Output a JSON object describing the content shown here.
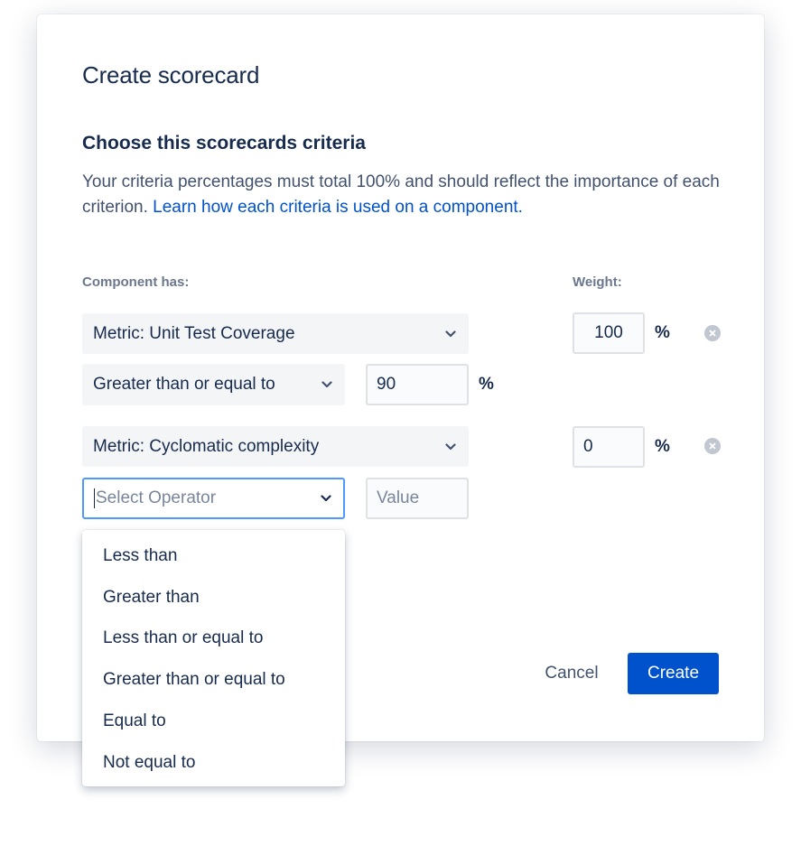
{
  "modal": {
    "title": "Create scorecard",
    "section_title": "Choose this scorecards criteria",
    "description": "Your criteria percentages must total 100% and should reflect the importance of each criterion. ",
    "learn_link": "Learn how each criteria is used on a component."
  },
  "columns": {
    "component_has": "Component has:",
    "weight": "Weight:"
  },
  "criteria": [
    {
      "metric": "Metric: Unit Test Coverage",
      "operator": "Greater than or equal to",
      "value": "90",
      "value_unit": "%",
      "weight": "100",
      "weight_unit": "%"
    },
    {
      "metric": "Metric: Cyclomatic complexity",
      "operator_placeholder": "Select Operator",
      "value_placeholder": "Value",
      "weight": "0",
      "weight_unit": "%"
    }
  ],
  "operator_menu": [
    "Less than",
    "Greater than",
    "Less than or equal to",
    "Greater than or equal to",
    "Equal to",
    "Not equal to"
  ],
  "footer": {
    "cancel": "Cancel",
    "create": "Create"
  },
  "colors": {
    "primary": "#0052CC",
    "focus": "#4C9AFF",
    "text": "#172B4D"
  }
}
